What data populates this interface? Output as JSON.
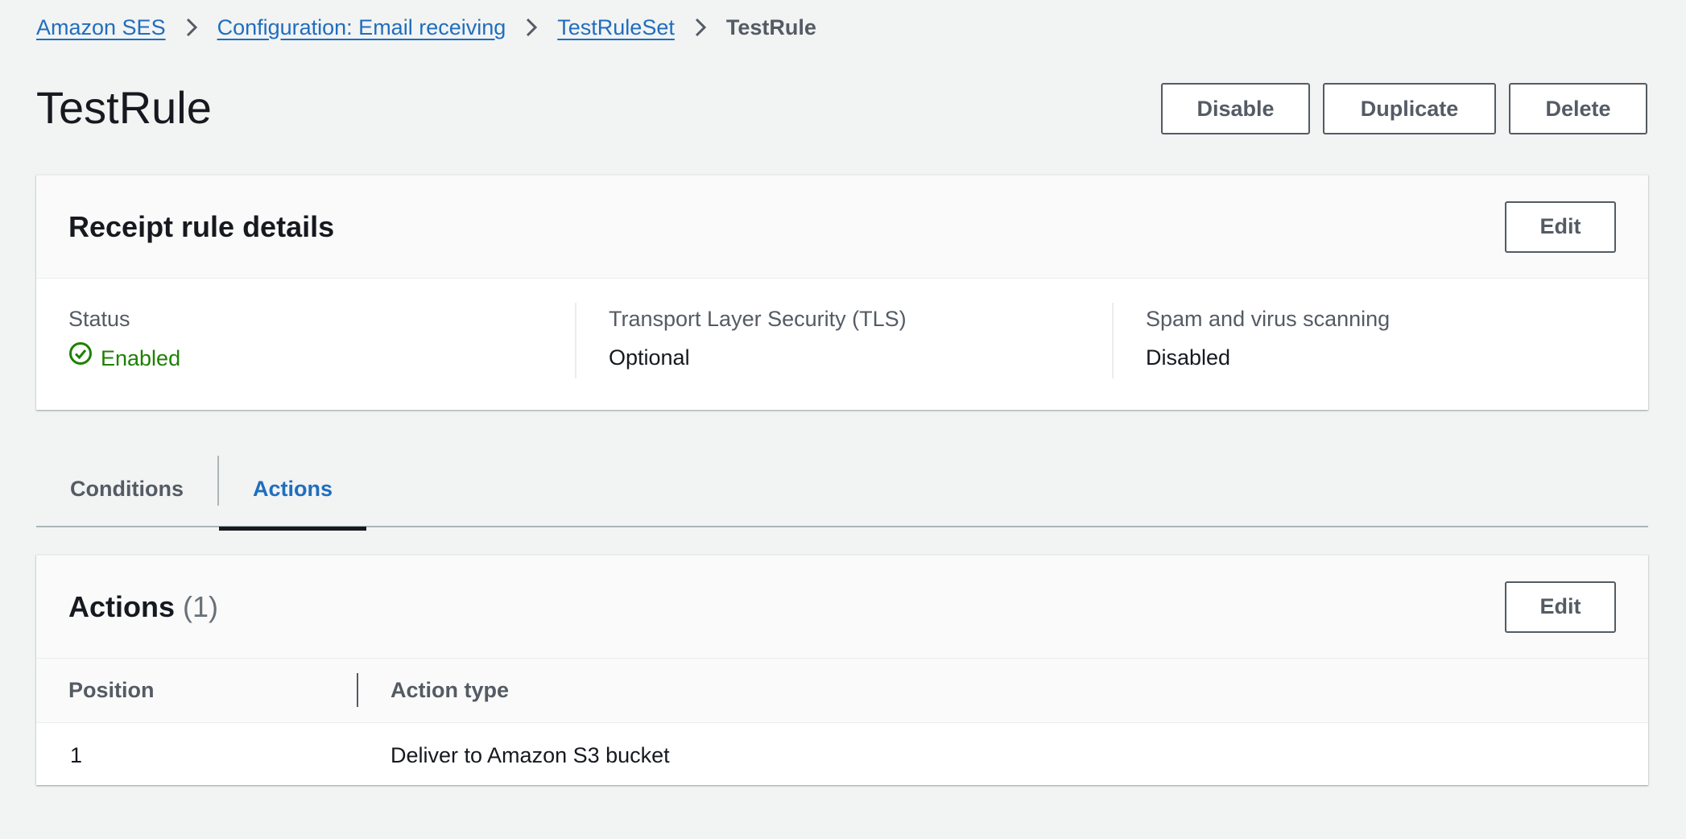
{
  "breadcrumb": {
    "items": [
      "Amazon SES",
      "Configuration: Email receiving",
      "TestRuleSet"
    ],
    "current": "TestRule"
  },
  "header": {
    "title": "TestRule",
    "buttons": {
      "disable": "Disable",
      "duplicate": "Duplicate",
      "delete": "Delete"
    }
  },
  "details": {
    "title": "Receipt rule details",
    "edit_label": "Edit",
    "status_label": "Status",
    "status_value": "Enabled",
    "tls_label": "Transport Layer Security (TLS)",
    "tls_value": "Optional",
    "spam_label": "Spam and virus scanning",
    "spam_value": "Disabled"
  },
  "tabs": [
    {
      "label": "Conditions",
      "active": false
    },
    {
      "label": "Actions",
      "active": true
    }
  ],
  "actions": {
    "title": "Actions",
    "count": "(1)",
    "edit_label": "Edit",
    "columns": [
      "Position",
      "Action type"
    ],
    "rows": [
      {
        "position": "1",
        "action_type": "Deliver to Amazon S3 bucket"
      }
    ]
  },
  "colors": {
    "link": "#1f6ebf",
    "success": "#1d8102",
    "background": "#f2f3f3",
    "text": "#16191f",
    "secondary_text": "#545b64"
  },
  "icons": {
    "breadcrumb_separator": "chevron-right-icon",
    "status": "status-success-icon"
  }
}
